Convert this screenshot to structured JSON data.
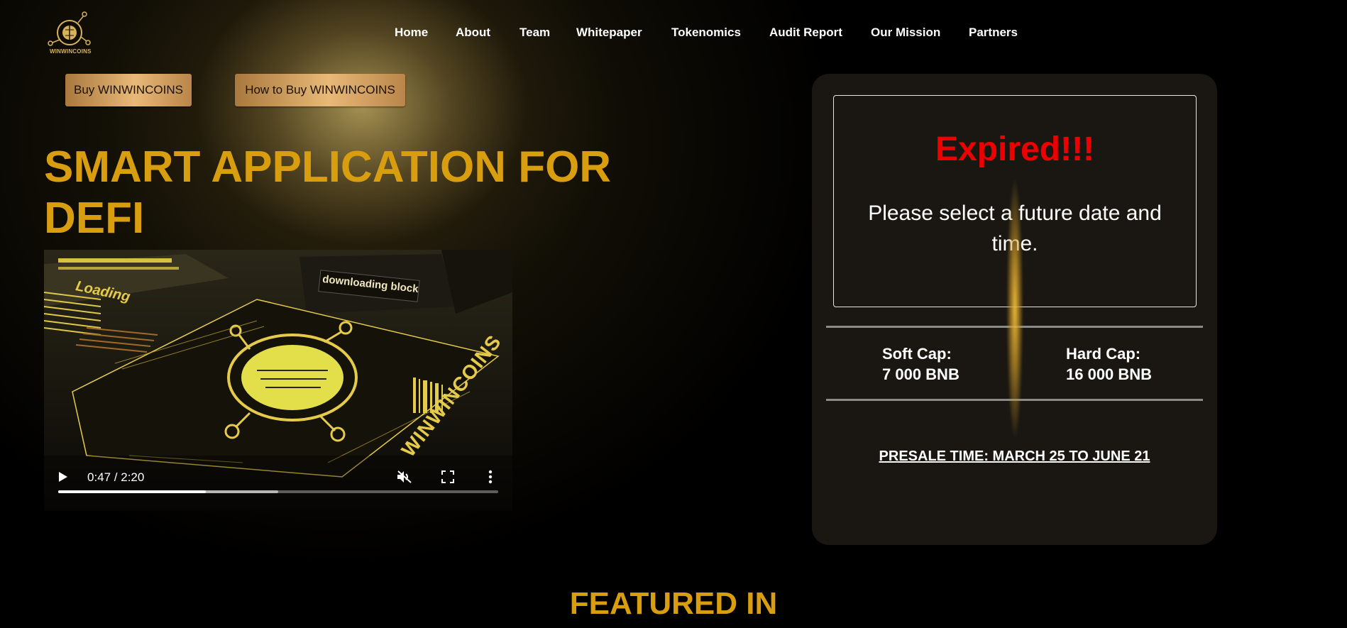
{
  "header": {
    "logo_text": "WINWINCOINS",
    "nav": [
      "Home",
      "About",
      "Team",
      "Whitepaper",
      "Tokenomics",
      "Audit Report",
      "Our Mission",
      "Partners"
    ]
  },
  "hero": {
    "buttons": [
      "Buy WINWINCOINS",
      "How to Buy WINWINCOINS"
    ],
    "headline": "SMART APPLICATION FOR DEFI"
  },
  "video": {
    "time_label": "0:47 / 2:20",
    "progress": 0.336,
    "buffered": 0.5,
    "scene_texts": {
      "loading": "Loading",
      "downloading": "downloading block",
      "brand": "WINWINCOINS"
    }
  },
  "presale": {
    "status": "Expired!!!",
    "message": "Please select a future date and time.",
    "soft_cap_label": "Soft Cap:",
    "soft_cap_value": "7 000 BNB",
    "hard_cap_label": "Hard Cap:",
    "hard_cap_value": "16 000 BNB",
    "presale_time": "PRESALE TIME: MARCH 25 TO JUNE 21"
  },
  "featured": {
    "title": "FEATURED IN"
  },
  "colors": {
    "accent_gold": "#d89e10",
    "expired_red": "#ef0000",
    "panel_bg": "#1a1712"
  }
}
